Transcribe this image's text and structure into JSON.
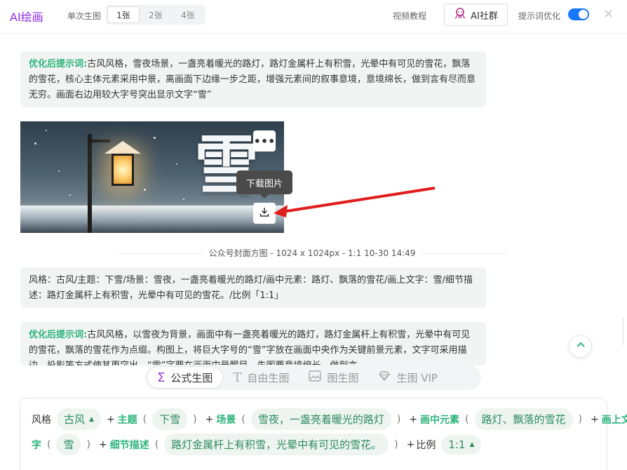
{
  "header": {
    "app_title": "AI绘画",
    "count_label": "单次生图",
    "count_options": [
      "1张",
      "2张",
      "4张"
    ],
    "video_link": "视频教程",
    "community_button": "AI社群",
    "prompt_optimize_label": "提示词优化",
    "prompt_optimize_on": true
  },
  "messages": {
    "optimized1_label": "优化后提示词:",
    "optimized1_text": "古风风格，雪夜场景，一盏亮着暖光的路灯，路灯金属杆上有积雪，光晕中有可见的雪花，飘落的雪花，核心主体元素采用中景，离画面下边缘一步之距，增强元素间的叙事意境，意境绵长，做到言有尽而意无穷。画面右边用较大字号突出显示文字“雪”",
    "image_big_char": "雪",
    "tooltip": "下载图片",
    "meta": "公众号封面方图 - 1024 x 1024px - 1:1      10-30 14:49",
    "params_text": "风格：古风/主题：下雪/场景：雪夜，一盏亮着暖光的路灯/画中元素：路灯、飘落的雪花/画上文字：雪/细节描述：路灯金属杆上有积雪，光晕中有可见的雪花。/比例「1:1」",
    "optimized2_label": "优化后提示词:",
    "optimized2_text": "古风风格，以雪夜为背景，画面中有一盏亮着暖光的路灯，路灯金属杆上有积雪，光晕中有可见的雪花，飘落的雪花作为点缀。构图上，将巨大字号的“雪”字放在画面中央作为关键前景元素，文字可采用描边、投影等方式使其更突出，“雪”字要在画面中最醒目，先图要意境绵长，做到言"
  },
  "mode_tabs": [
    {
      "label": "公式生图",
      "icon": "sigma-icon"
    },
    {
      "label": "自由生图",
      "icon": "text-t-icon"
    },
    {
      "label": "图生图",
      "icon": "image-icon"
    },
    {
      "label": "生图 VIP",
      "icon": "diamond-icon"
    }
  ],
  "formula": {
    "style_label": "风格",
    "style_value": "古风",
    "theme_kw": "主题",
    "theme_value": "下雪",
    "scene_kw": "场景",
    "scene_value": "雪夜，一盏亮着暖光的路灯",
    "elements_kw": "画中元素",
    "elements_value": "路灯、飘落的雪花",
    "text_kw_a": "画上文",
    "text_kw_b": "字",
    "text_value": "雪",
    "detail_kw": "细节描述",
    "detail_value": "路灯金属杆上有积雪，光晕中有可见的雪花。",
    "ratio_label": "比例",
    "ratio_value": "1:1"
  }
}
